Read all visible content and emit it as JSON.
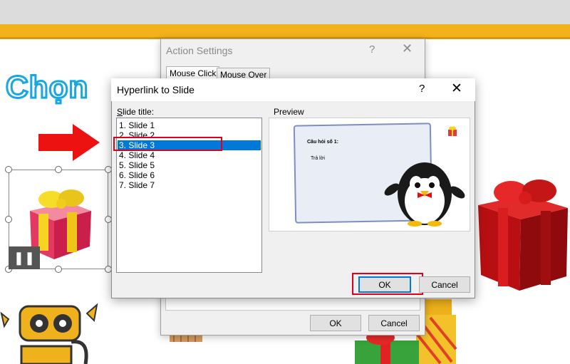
{
  "slide": {
    "heading": "Chọn"
  },
  "action_settings": {
    "title": "Action Settings",
    "help_glyph": "?",
    "close_glyph": "✕",
    "tabs": [
      {
        "label": "Mouse Click",
        "active": true
      },
      {
        "label": "Mouse Over",
        "active": false
      }
    ],
    "ok_label": "OK",
    "cancel_label": "Cancel"
  },
  "hyperlink_dialog": {
    "title": "Hyperlink to Slide",
    "help_glyph": "?",
    "close_glyph": "✕",
    "slide_title_label": "Slide title:",
    "slide_title_mnemonic": "S",
    "slide_title_rest": "lide title:",
    "preview_label": "Preview",
    "slides": [
      "1. Slide 1",
      "2. Slide 2",
      "3. Slide 3",
      "4. Slide 4",
      "5. Slide 5",
      "6. Slide 6",
      "7. Slide 7"
    ],
    "selected_index": 2,
    "preview": {
      "line1": "Câu hỏi số 1:",
      "line2": "Trả lời"
    },
    "ok_label": "OK",
    "cancel_label": "Cancel"
  },
  "colors": {
    "accent_blue": "#0078d7",
    "highlight_red": "#e0001b",
    "slide_yellow": "#f2b21b"
  }
}
